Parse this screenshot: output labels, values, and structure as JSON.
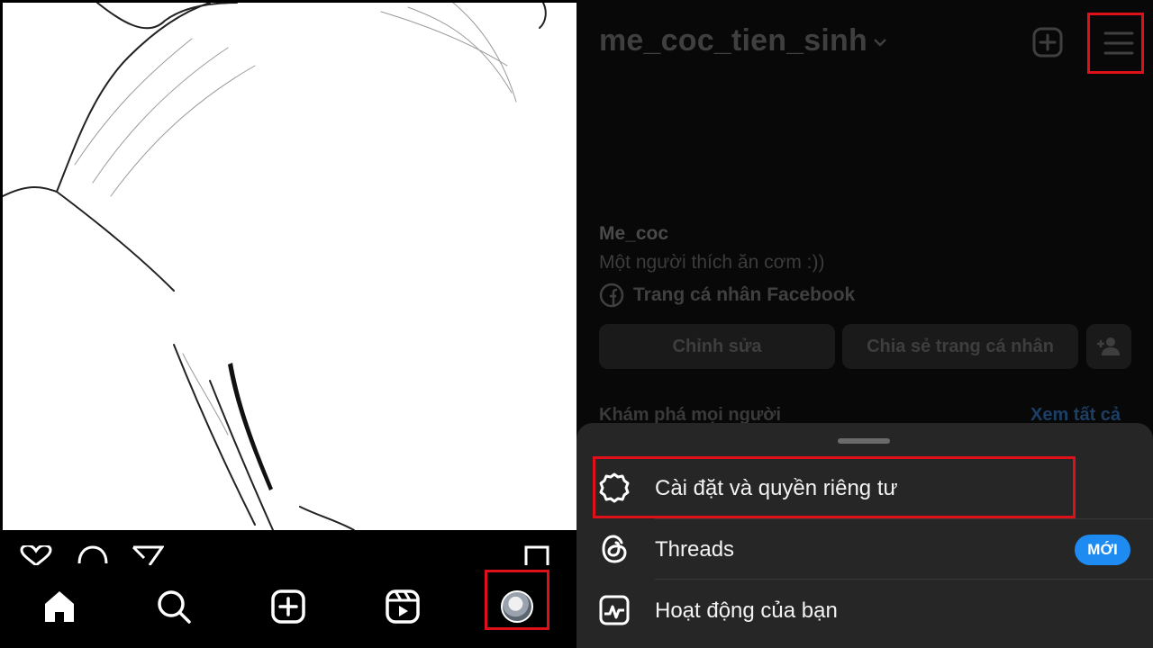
{
  "left_panel": {
    "post_actions": {
      "like_icon": "heart-icon",
      "comment_icon": "comment-icon",
      "share_icon": "send-icon",
      "save_icon": "bookmark-icon"
    },
    "bottom_nav": {
      "items": [
        {
          "icon": "home-icon"
        },
        {
          "icon": "search-icon"
        },
        {
          "icon": "create-icon"
        },
        {
          "icon": "reels-icon"
        },
        {
          "icon": "profile-avatar"
        }
      ]
    }
  },
  "right_panel": {
    "header": {
      "username": "me_coc_tien_sinh",
      "dropdown_icon": "chevron-down-icon",
      "create_icon": "plus-square-icon",
      "menu_icon": "hamburger-menu-icon"
    },
    "profile": {
      "display_name": "Me_coc",
      "bio": "Một người thích ăn cơm :))",
      "facebook_link": "Trang cá nhân Facebook"
    },
    "buttons": {
      "edit": "Chỉnh sửa",
      "share": "Chia sẻ trang cá nhân",
      "add_person_icon": "add-person-icon"
    },
    "discover": {
      "title": "Khám phá mọi người",
      "see_all": "Xem tất cả"
    },
    "menu_sheet": {
      "items": [
        {
          "label": "Cài đặt và quyền riêng tư",
          "icon": "settings-gear-icon"
        },
        {
          "label": "Threads",
          "icon": "threads-icon",
          "badge": "MỚI"
        },
        {
          "label": "Hoạt động của bạn",
          "icon": "activity-icon"
        }
      ]
    }
  },
  "colors": {
    "highlight_box": "#e0101b",
    "badge_blue": "#1d8bf1",
    "sheet_bg": "#262626"
  }
}
